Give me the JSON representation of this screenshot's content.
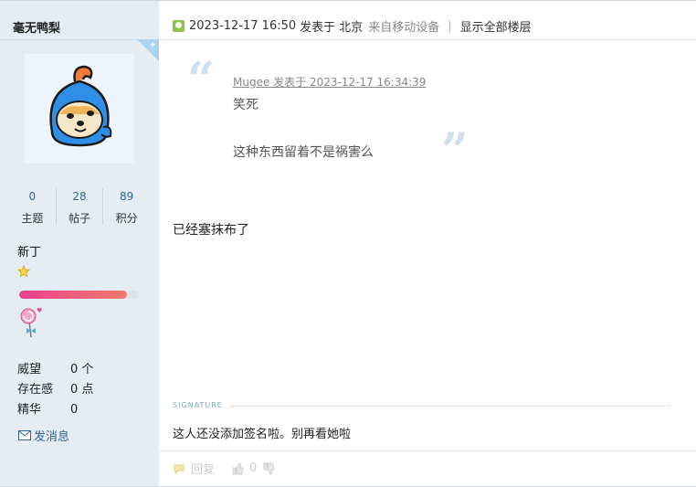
{
  "user": {
    "name": "毫无鸭梨",
    "stats": [
      {
        "value": "0",
        "label": "主题"
      },
      {
        "value": "28",
        "label": "帖子"
      },
      {
        "value": "89",
        "label": "积分"
      }
    ],
    "rank": "新丁",
    "level_progress": 0.9,
    "info": [
      {
        "key": "威望",
        "value": "0 个"
      },
      {
        "key": "存在感",
        "value": "0 点"
      },
      {
        "key": "精华",
        "value": "0"
      }
    ],
    "message_link": "发消息"
  },
  "post": {
    "datetime": "2023-12-17 16:50",
    "posted_at": "发表于",
    "location": "北京",
    "source": "来自移动设备",
    "show_all": "显示全部楼层",
    "quote": {
      "meta": "Mugee 发表于 2023-12-17 16:34:39",
      "line1": "笑死",
      "line2": "这种东西留着不是祸害么"
    },
    "body": "已经塞抹布了",
    "signature_label": "SIGNATURE",
    "signature": "这人还没添加签名啦。别再看她啦",
    "actions": {
      "reply": "回复",
      "likes": "0"
    }
  },
  "colors": {
    "sidebar_bg": "#e5edf2",
    "link": "#336699",
    "progress": "#e8408f"
  }
}
